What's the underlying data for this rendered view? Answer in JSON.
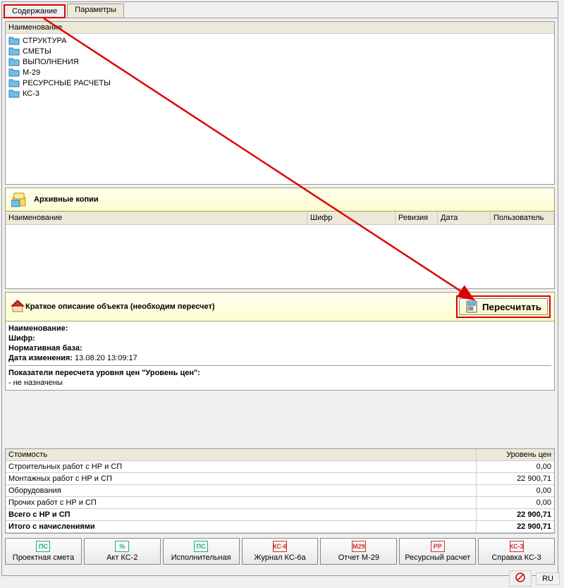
{
  "tabs": {
    "content": "Содержание",
    "params": "Параметры"
  },
  "tree": {
    "header": "Наименование",
    "items": [
      "СТРУКТУРА",
      "СМЕТЫ",
      "ВЫПОЛНЕНИЯ",
      "М-29",
      "РЕСУРСНЫЕ РАСЧЕТЫ",
      "КС-3"
    ]
  },
  "archive": {
    "title": "Архивные копии",
    "cols": {
      "name": "Наименование",
      "shifr": "Шифр",
      "rev": "Ревизия",
      "date": "Дата",
      "user": "Пользователь"
    }
  },
  "desc": {
    "title": "Краткое описание объекта (необходим пересчет)",
    "recalc": "Пересчитать",
    "fields": {
      "name_label": "Наименование:",
      "shifr_label": "Шифр:",
      "base_label": "Нормативная база:",
      "date_label": "Дата изменения:",
      "date_value": "13.08.20 13:09:17",
      "indicators_label": "Показатели пересчета уровня цен \"Уровень цен\":",
      "indicators_value": "- не назначены"
    }
  },
  "cost": {
    "header_label": "Стоимость",
    "header_value": "Уровень цен",
    "rows": [
      {
        "label": "Строительных работ с НР и СП",
        "value": "0,00",
        "bold": false
      },
      {
        "label": "Монтажных работ с НР и СП",
        "value": "22 900,71",
        "bold": false
      },
      {
        "label": "Оборудования",
        "value": "0,00",
        "bold": false
      },
      {
        "label": "Прочих работ с НР и СП",
        "value": "0,00",
        "bold": false
      },
      {
        "label": "Всего с НР и СП",
        "value": "22 900,71",
        "bold": true
      },
      {
        "label": "Итого с начислениями",
        "value": "22 900,71",
        "bold": true
      }
    ]
  },
  "toolbar": {
    "items": [
      {
        "icon": "ПС",
        "label": "Проектная смета",
        "color": "#2a8"
      },
      {
        "icon": "%",
        "label": "Акт КС-2",
        "color": "#2a8"
      },
      {
        "icon": "ПС",
        "label": "Исполнительная",
        "color": "#2a8"
      },
      {
        "icon": "КС-6",
        "label": "Журнал КС-6а",
        "color": "#c33"
      },
      {
        "icon": "М29",
        "label": "Отчет М-29",
        "color": "#c33"
      },
      {
        "icon": "РР",
        "label": "Ресурсный расчет",
        "color": "#c33"
      },
      {
        "icon": "КС-3",
        "label": "Справка КС-3",
        "color": "#c33"
      }
    ]
  },
  "status": {
    "lang": "RU"
  }
}
